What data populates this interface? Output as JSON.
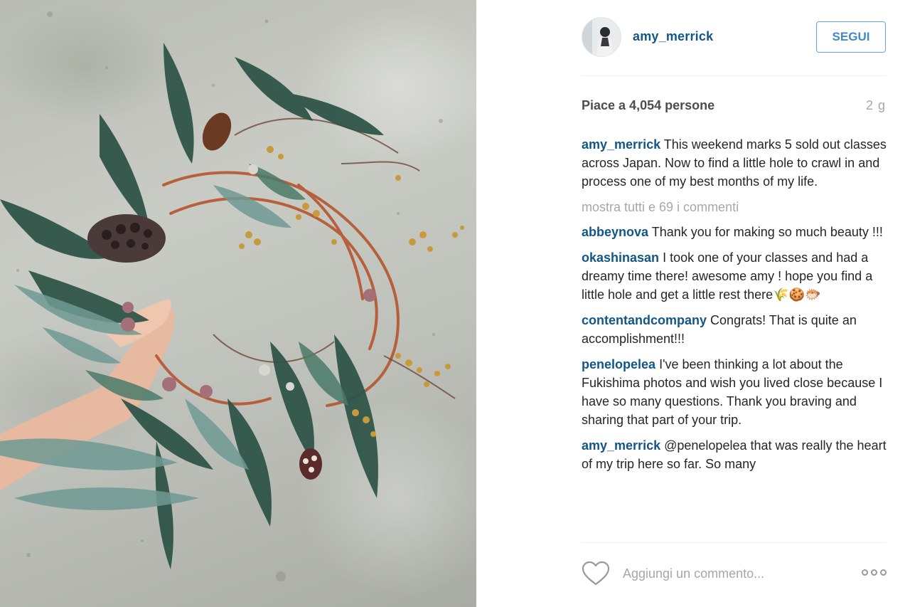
{
  "post": {
    "photo_alt": "wreath-photo",
    "author": "amy_merrick",
    "follow_label": "SEGUI",
    "likes_text": "Piace a 4,054 persone",
    "timestamp": "2 g",
    "caption": "This weekend marks 5 sold out classes across Japan. Now to find a little hole to crawl in and process one of my best months of my life.",
    "show_all_comments": "mostra tutti e 69 i commenti"
  },
  "comments": [
    {
      "user": "abbeynova",
      "text": "Thank you for making so much beauty !!!"
    },
    {
      "user": "okashinasan",
      "text": "I took one of your classes and had a dreamy time there! awesome amy ! hope you find a little hole and get a little rest there🌾🍪🐡"
    },
    {
      "user": "contentandcompany",
      "text": "Congrats! That is quite an accomplishment!!!"
    },
    {
      "user": "penelopelea",
      "text": "I've been thinking a lot about the Fukishima photos and wish you lived close because I have so many questions. Thank you braving and sharing that part of your trip."
    },
    {
      "user": "amy_merrick",
      "text": "@penelopelea that was really the heart of my trip here so far. So many"
    }
  ],
  "footer": {
    "comment_placeholder": "Aggiungi un commento...",
    "heart_icon": "heart-icon",
    "more_icon": "more-options-icon"
  },
  "colors": {
    "link_blue": "#125688",
    "follow_blue": "#3f89c9",
    "muted_gray": "#a5a7aa"
  }
}
